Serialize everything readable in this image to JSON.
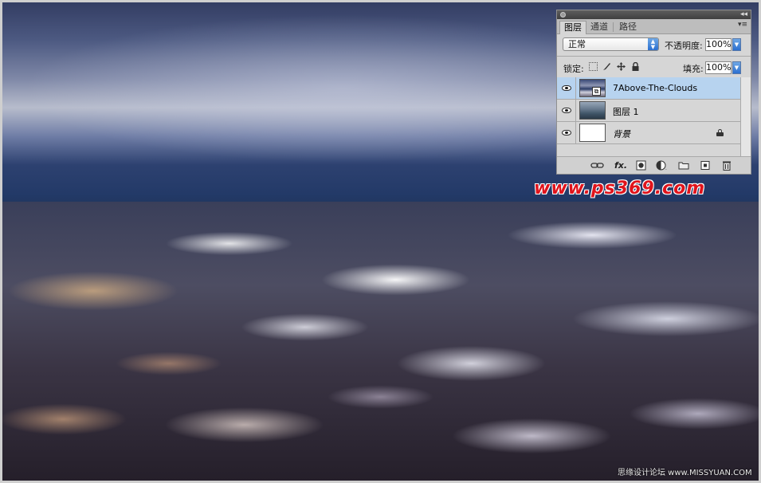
{
  "panel": {
    "tabs": [
      {
        "label": "图层",
        "active": true
      },
      {
        "label": "通道",
        "active": false
      },
      {
        "label": "路径",
        "active": false
      }
    ],
    "blend_mode": "正常",
    "opacity_label": "不透明度:",
    "opacity_value": "100%",
    "lock_label": "锁定:",
    "fill_label": "填充:",
    "fill_value": "100%",
    "layers": [
      {
        "name": "7Above-The-Clouds",
        "selected": true,
        "visible": true,
        "thumbnail": "sky",
        "smart_object": true,
        "locked": false
      },
      {
        "name": "图层 1",
        "selected": false,
        "visible": true,
        "thumbnail": "city",
        "smart_object": false,
        "locked": false
      },
      {
        "name": "背景",
        "selected": false,
        "visible": true,
        "thumbnail": "white",
        "smart_object": false,
        "locked": true
      }
    ],
    "bottom_icons": [
      "link-icon",
      "fx-icon",
      "mask-icon",
      "adjustment-icon",
      "folder-icon",
      "new-layer-icon",
      "trash-icon"
    ],
    "fx_label": "fx"
  },
  "watermark": "www.ps369.com",
  "credit": "思缘设计论坛 www.MISSYUAN.COM"
}
